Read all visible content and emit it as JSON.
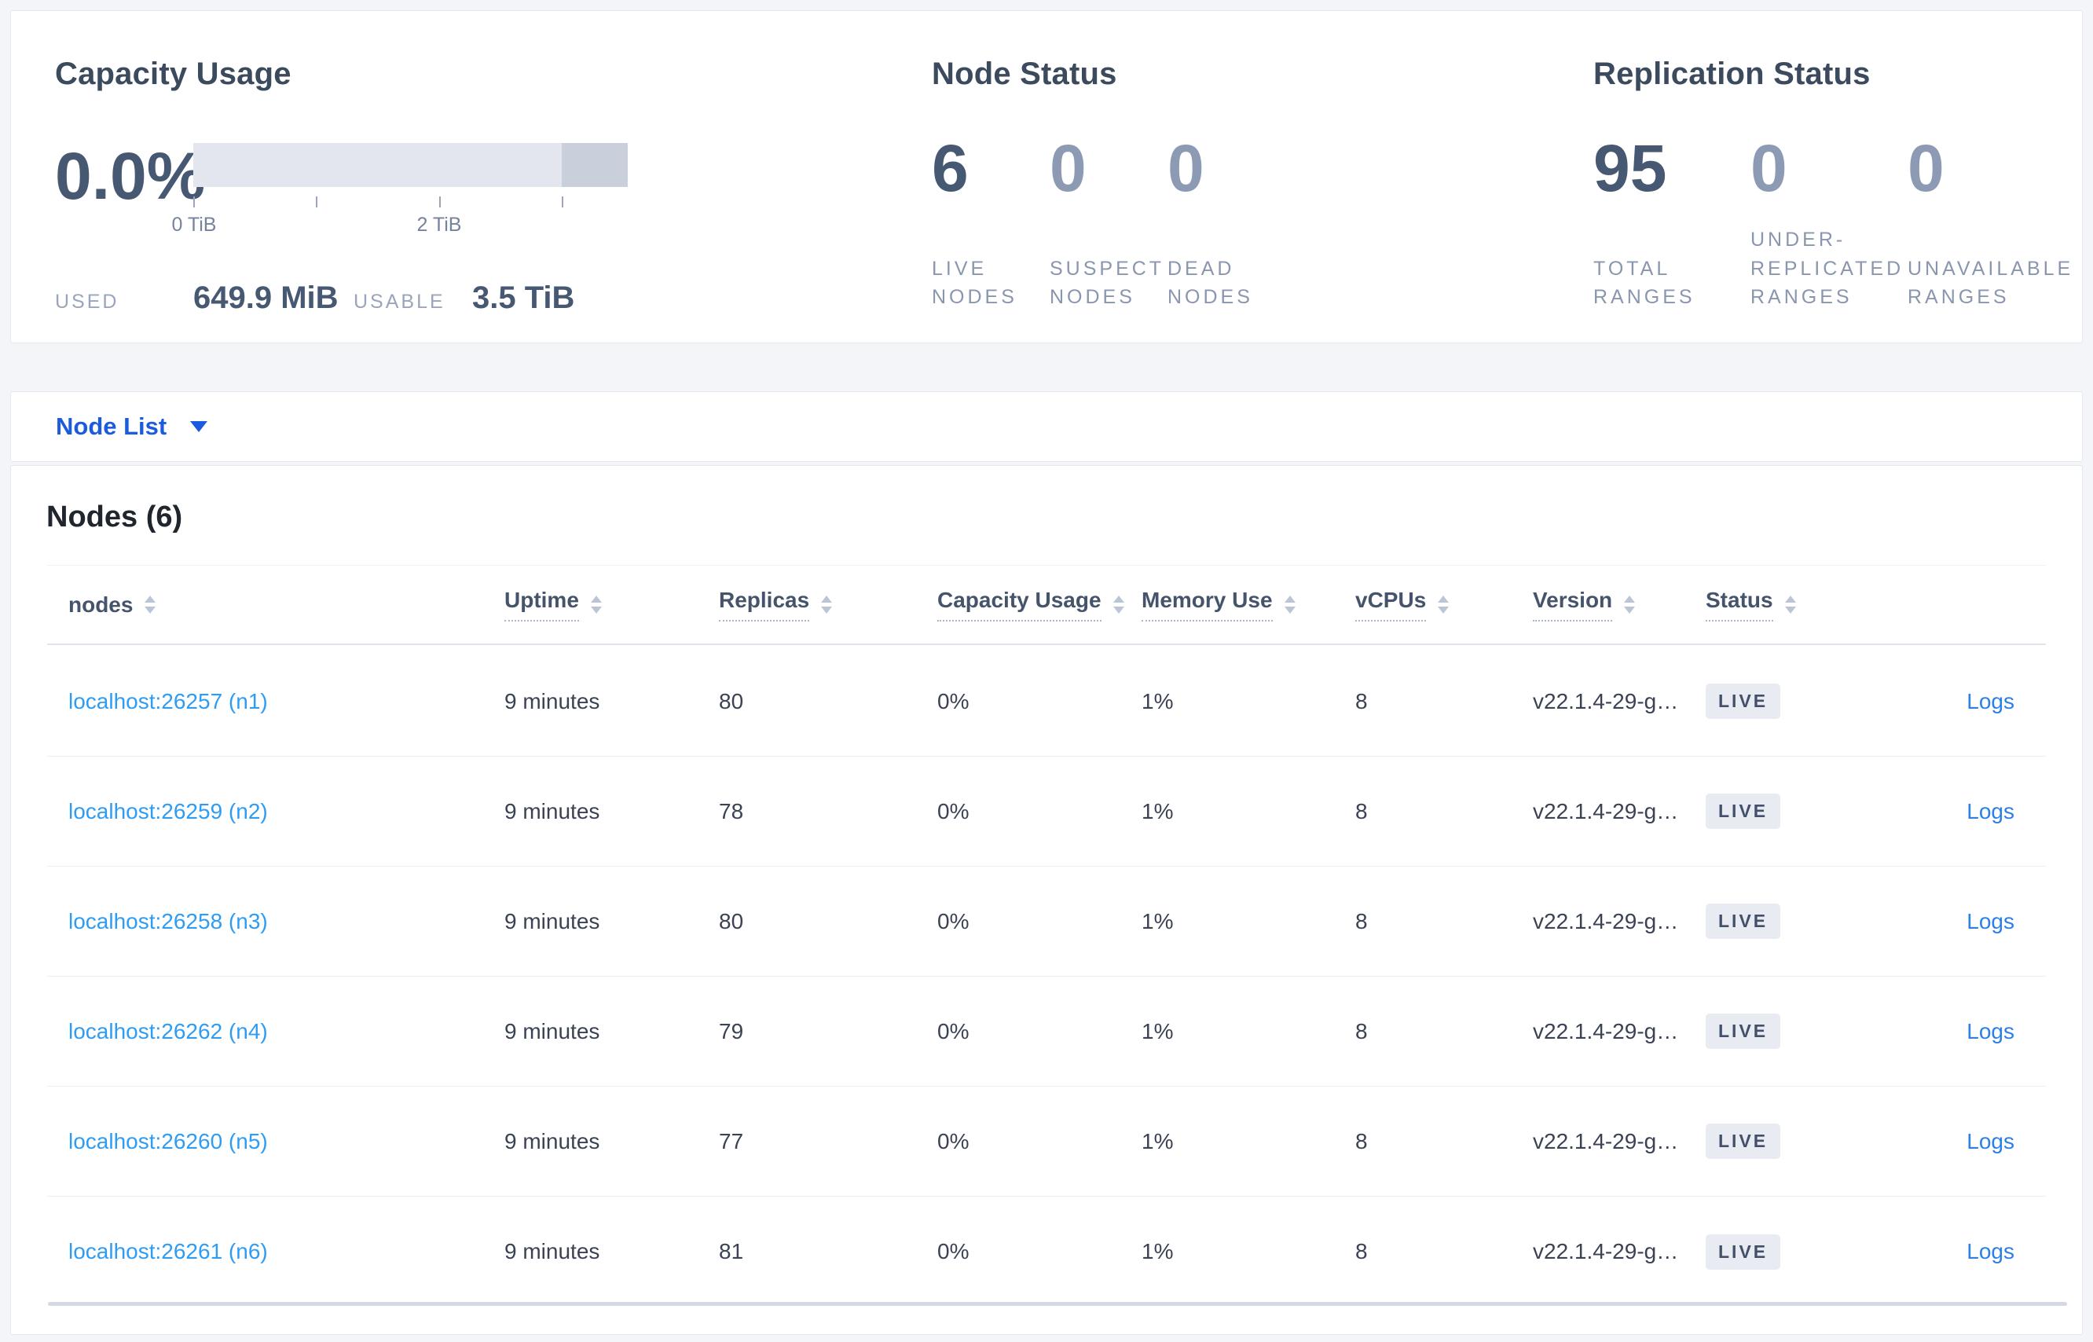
{
  "overview": {
    "capacity": {
      "title": "Capacity Usage",
      "percent": "0.0%",
      "ticks": [
        "0 TiB",
        "2 TiB"
      ],
      "used_label": "USED",
      "used_value": "649.9 MiB",
      "usable_label": "USABLE",
      "usable_value": "3.5 TiB"
    },
    "node_status": {
      "title": "Node Status",
      "stats": [
        {
          "value": "6",
          "label": "LIVE NODES",
          "muted": false
        },
        {
          "value": "0",
          "label": "SUSPECT NODES",
          "muted": true
        },
        {
          "value": "0",
          "label": "DEAD NODES",
          "muted": true
        }
      ]
    },
    "replication": {
      "title": "Replication Status",
      "stats": [
        {
          "value": "95",
          "label": "TOTAL RANGES",
          "muted": false
        },
        {
          "value": "0",
          "label": "UNDER-REPLICATED RANGES",
          "muted": true
        },
        {
          "value": "0",
          "label": "UNAVAILABLE RANGES",
          "muted": true
        }
      ]
    }
  },
  "view_selector": {
    "label": "Node List"
  },
  "nodes_panel": {
    "title": "Nodes (6)",
    "columns": [
      {
        "label": "nodes",
        "underline": false,
        "sort": true
      },
      {
        "label": "Uptime",
        "underline": true,
        "sort": true
      },
      {
        "label": "Replicas",
        "underline": true,
        "sort": true
      },
      {
        "label": "Capacity Usage",
        "underline": true,
        "sort": true
      },
      {
        "label": "Memory Use",
        "underline": true,
        "sort": true
      },
      {
        "label": "vCPUs",
        "underline": true,
        "sort": true
      },
      {
        "label": "Version",
        "underline": true,
        "sort": true
      },
      {
        "label": "Status",
        "underline": true,
        "sort": true
      },
      {
        "label": "",
        "underline": false,
        "sort": false
      }
    ],
    "rows": [
      {
        "address": "localhost:26257 (n1)",
        "uptime": "9 minutes",
        "replicas": "80",
        "capacity": "0%",
        "memory": "1%",
        "vcpus": "8",
        "version": "v22.1.4-29-g…",
        "status": "LIVE",
        "logs": "Logs"
      },
      {
        "address": "localhost:26259 (n2)",
        "uptime": "9 minutes",
        "replicas": "78",
        "capacity": "0%",
        "memory": "1%",
        "vcpus": "8",
        "version": "v22.1.4-29-g…",
        "status": "LIVE",
        "logs": "Logs"
      },
      {
        "address": "localhost:26258 (n3)",
        "uptime": "9 minutes",
        "replicas": "80",
        "capacity": "0%",
        "memory": "1%",
        "vcpus": "8",
        "version": "v22.1.4-29-g…",
        "status": "LIVE",
        "logs": "Logs"
      },
      {
        "address": "localhost:26262 (n4)",
        "uptime": "9 minutes",
        "replicas": "79",
        "capacity": "0%",
        "memory": "1%",
        "vcpus": "8",
        "version": "v22.1.4-29-g…",
        "status": "LIVE",
        "logs": "Logs"
      },
      {
        "address": "localhost:26260 (n5)",
        "uptime": "9 minutes",
        "replicas": "77",
        "capacity": "0%",
        "memory": "1%",
        "vcpus": "8",
        "version": "v22.1.4-29-g…",
        "status": "LIVE",
        "logs": "Logs"
      },
      {
        "address": "localhost:26261 (n6)",
        "uptime": "9 minutes",
        "replicas": "81",
        "capacity": "0%",
        "memory": "1%",
        "vcpus": "8",
        "version": "v22.1.4-29-g…",
        "status": "LIVE",
        "logs": "Logs"
      }
    ]
  },
  "chart_data": {
    "type": "bar",
    "title": "Capacity Usage",
    "categories": [
      "used",
      "usable"
    ],
    "values_label": [
      "649.9 MiB",
      "3.5 TiB"
    ],
    "percent_used": 0.0,
    "axis_unit": "TiB",
    "axis_ticks": [
      0,
      1,
      2,
      3
    ],
    "axis_tick_labels_shown": [
      "0 TiB",
      "2 TiB"
    ],
    "bar_extent_tib": 3.5,
    "dark_segment_from_tib": 3.0
  },
  "colors": {
    "page_bg": "#f3f5f9",
    "card_bg": "#ffffff",
    "accent_selector_blue": "#1b5be0",
    "node_link_blue": "#2e9cf3",
    "logs_link_blue": "#2b80e6",
    "stat_primary": "#475872",
    "stat_muted": "#8d9ab4",
    "bar_track": "#e3e6ee",
    "bar_dark_segment": "#c9cfdb",
    "badge_bg": "#e8ebf1",
    "badge_text": "#44506a"
  }
}
